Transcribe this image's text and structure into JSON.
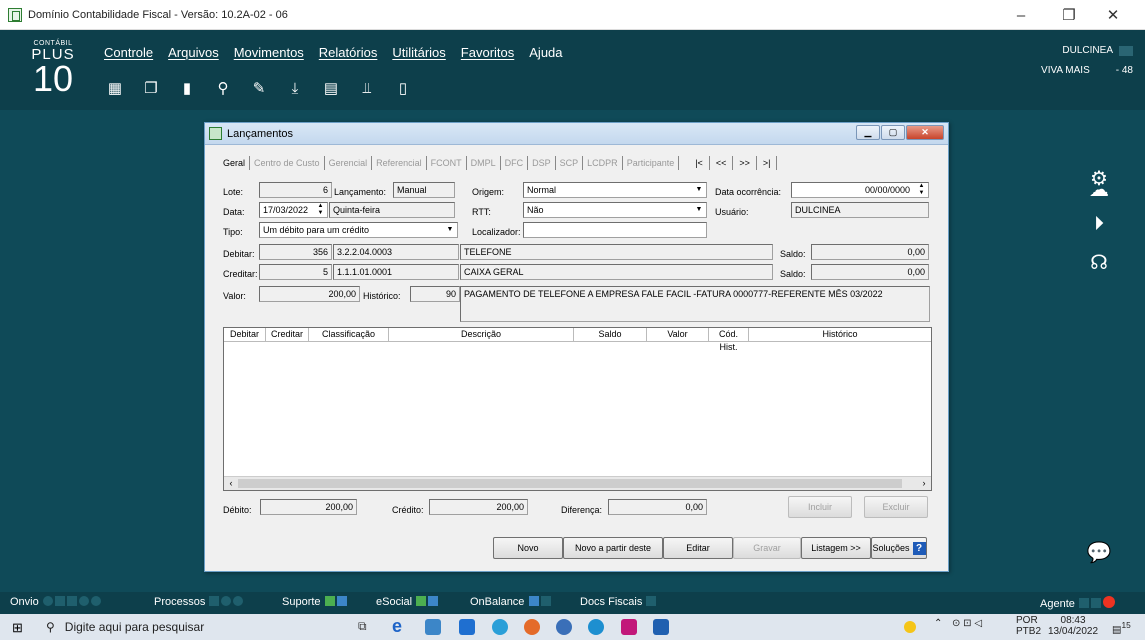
{
  "window": {
    "title": "Domínio Contabilidade Fiscal  - Versão: 10.2A-02 - 06",
    "minimize": "–",
    "maximize": "❐",
    "close": "✕"
  },
  "logo": {
    "small": "CONTÁBIL",
    "plus": "PLUS",
    "ten": "10"
  },
  "menu": [
    "Controle",
    "Arquivos",
    "Movimentos",
    "Relatórios",
    "Utilitários",
    "Favoritos",
    "Ajuda"
  ],
  "toolbar_icons": [
    "building-icon",
    "documents-icon",
    "page-icon",
    "search-icon",
    "doc-edit-icon",
    "download-icon",
    "calculator-icon",
    "chart-search-icon",
    "book-icon"
  ],
  "user": {
    "name": "DULCINEA",
    "company": "VIVA MAIS",
    "code": "- 48"
  },
  "side_icons": [
    "gear-icon",
    "cloud-icon",
    "play-icon",
    "headset-icon"
  ],
  "dialog": {
    "title": "Lançamentos",
    "tabs": [
      "Geral",
      "Centro de Custo",
      "Gerencial",
      "Referencial",
      "FCONT",
      "DMPL",
      "DFC",
      "DSP",
      "SCP",
      "LCDPR",
      "Participante"
    ],
    "nav": [
      "|<",
      "<<",
      ">>",
      ">|"
    ],
    "labels": {
      "lote": "Lote:",
      "lancamento": "Lançamento:",
      "origem": "Origem:",
      "data_ocorrencia": "Data ocorrência:",
      "data": "Data:",
      "rtt": "RTT:",
      "usuario": "Usuário:",
      "tipo": "Tipo:",
      "localizador": "Localizador:",
      "debitar": "Debitar:",
      "creditar": "Creditar:",
      "saldo": "Saldo:",
      "valor": "Valor:",
      "historico": "Histórico:",
      "debito": "Débito:",
      "credito": "Crédito:",
      "diferenca": "Diferença:"
    },
    "fields": {
      "lote": "6",
      "lancamento": "Manual",
      "origem": "Normal",
      "data_ocorrencia": "00/00/0000",
      "data": "17/03/2022",
      "dia_semana": "Quinta-feira",
      "rtt": "Não",
      "usuario": "DULCINEA",
      "tipo": "Um débito para um crédito",
      "localizador": "",
      "debitar_codigo": "356",
      "debitar_classificacao": "3.2.2.04.0003",
      "debitar_descricao": "TELEFONE",
      "debitar_saldo": "0,00",
      "creditar_codigo": "5",
      "creditar_classificacao": "1.1.1.01.0001",
      "creditar_descricao": "CAIXA GERAL",
      "creditar_saldo": "0,00",
      "valor": "200,00",
      "historico_codigo": "90",
      "historico_texto": "PAGAMENTO DE TELEFONE A EMPRESA FALE FACIL -FATURA 0000777-REFERENTE MÊS 03/2022",
      "total_debito": "200,00",
      "total_credito": "200,00",
      "diferenca": "0,00"
    },
    "grid_columns": [
      "Debitar",
      "Creditar",
      "Classificação",
      "Descrição",
      "Saldo",
      "Valor",
      "Cód. Hist.",
      "Histórico"
    ],
    "buttons": {
      "incluir": "Incluir",
      "excluir": "Excluir",
      "novo": "Novo",
      "novo_partir": "Novo a partir deste",
      "editar": "Editar",
      "gravar": "Gravar",
      "listagem": "Listagem >>",
      "solucoes": "Soluções",
      "help": "?"
    }
  },
  "bottombar": {
    "onvio": "Onvio",
    "processos": "Processos",
    "suporte": "Suporte",
    "esocial": "eSocial",
    "onbalance": "OnBalance",
    "docs_fiscais": "Docs Fiscais",
    "agente": "Agente"
  },
  "taskbar": {
    "search_placeholder": "Digite aqui para pesquisar",
    "lang": "POR",
    "lang2": "PTB2",
    "time": "08:43",
    "date": "13/04/2022",
    "notif_count": "15"
  }
}
